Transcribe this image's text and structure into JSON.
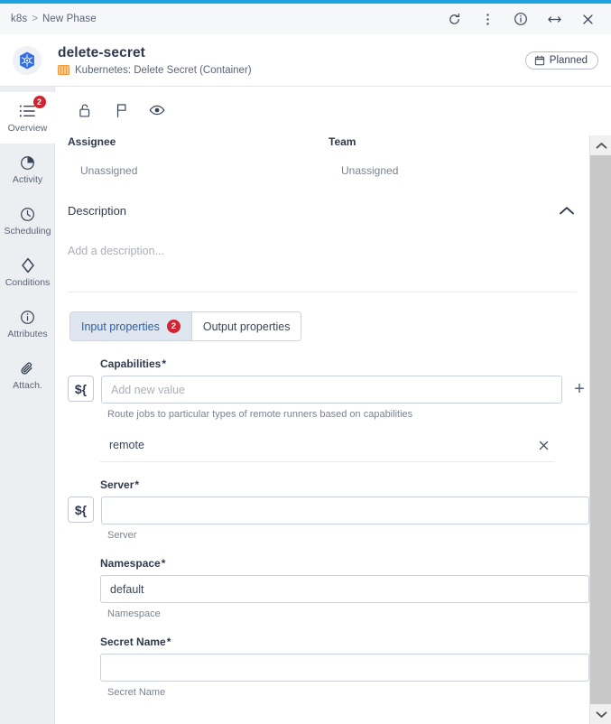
{
  "window": {
    "breadcrumb": {
      "root": "k8s",
      "separator": ">",
      "current": "New Phase"
    },
    "actions": [
      {
        "name": "refresh",
        "label": "Refresh"
      },
      {
        "name": "more",
        "label": "More options"
      },
      {
        "name": "info",
        "label": "Info"
      },
      {
        "name": "expand",
        "label": "Expand"
      },
      {
        "name": "close",
        "label": "Close"
      }
    ],
    "accent_color": "#1fa2dd"
  },
  "header": {
    "avatar_icon": "kubernetes-logo-icon",
    "title": "delete-secret",
    "subtitle_icon": "container-icon",
    "subtitle": "Kubernetes: Delete Secret (Container)",
    "status_badge": {
      "icon": "calendar-icon",
      "label": "Planned"
    }
  },
  "sidebar": {
    "items": [
      {
        "label": "Overview",
        "icon": "list-icon",
        "badge": "2",
        "active": true
      },
      {
        "label": "Activity",
        "icon": "pie-clock-icon",
        "badge": null,
        "active": false
      },
      {
        "label": "Scheduling",
        "icon": "clock-icon",
        "badge": null,
        "active": false
      },
      {
        "label": "Conditions",
        "icon": "diamond-icon",
        "badge": null,
        "active": false
      },
      {
        "label": "Attributes",
        "icon": "info-icon",
        "badge": null,
        "active": false
      },
      {
        "label": "Attach.",
        "icon": "paperclip-icon",
        "badge": null,
        "active": false
      }
    ]
  },
  "toolbar": {
    "actions": [
      {
        "name": "lock",
        "icon": "unlock-icon",
        "label": "Lock"
      },
      {
        "name": "flag",
        "icon": "flag-icon",
        "label": "Flag"
      },
      {
        "name": "watch",
        "icon": "eye-icon",
        "label": "Watch"
      }
    ]
  },
  "meta": {
    "assignee_label": "Assignee",
    "assignee_value": "Unassigned",
    "team_label": "Team",
    "team_value": "Unassigned"
  },
  "description": {
    "title": "Description",
    "collapse_icon": "chevron-up-icon",
    "placeholder": "Add a description..."
  },
  "tabs": [
    {
      "label": "Input properties",
      "badge": "2",
      "active": true
    },
    {
      "label": "Output properties",
      "badge": null,
      "active": false
    }
  ],
  "form": {
    "variable_button_label": "${",
    "add_button_label": "+",
    "fields": [
      {
        "name": "capabilities",
        "label": "Capabilities",
        "required": true,
        "required_marker": "*",
        "type": "multi-value",
        "value": "",
        "placeholder": "Add new value",
        "hint": "Route jobs to particular types of remote runners based on capabilities",
        "has_variable_button": true,
        "has_add_button": true,
        "values": [
          {
            "text": "remote",
            "remove_icon": "close-icon"
          }
        ]
      },
      {
        "name": "server",
        "label": "Server",
        "required": true,
        "required_marker": "*",
        "type": "select",
        "value": "",
        "placeholder": "",
        "hint": "Server",
        "has_variable_button": true,
        "has_add_button": false,
        "caret_icon": "chevron-down-icon"
      },
      {
        "name": "namespace",
        "label": "Namespace",
        "required": true,
        "required_marker": "*",
        "type": "text",
        "value": "default",
        "placeholder": "",
        "hint": "Namespace",
        "has_variable_button": false,
        "has_add_button": false
      },
      {
        "name": "secret-name",
        "label": "Secret Name",
        "required": true,
        "required_marker": "*",
        "type": "text",
        "value": "",
        "placeholder": "",
        "hint": "Secret Name",
        "has_variable_button": false,
        "has_add_button": false
      }
    ]
  },
  "scrollbar": {
    "up_icon": "chevron-up-icon",
    "down_icon": "chevron-down-icon"
  },
  "colors": {
    "accent": "#1fa2dd",
    "badge_red": "#d32330",
    "tab_active_bg": "#dfe6f0",
    "tab_active_text": "#2b5fa8",
    "container_orange": "#f5a042",
    "k8s_blue": "#326ce5"
  }
}
